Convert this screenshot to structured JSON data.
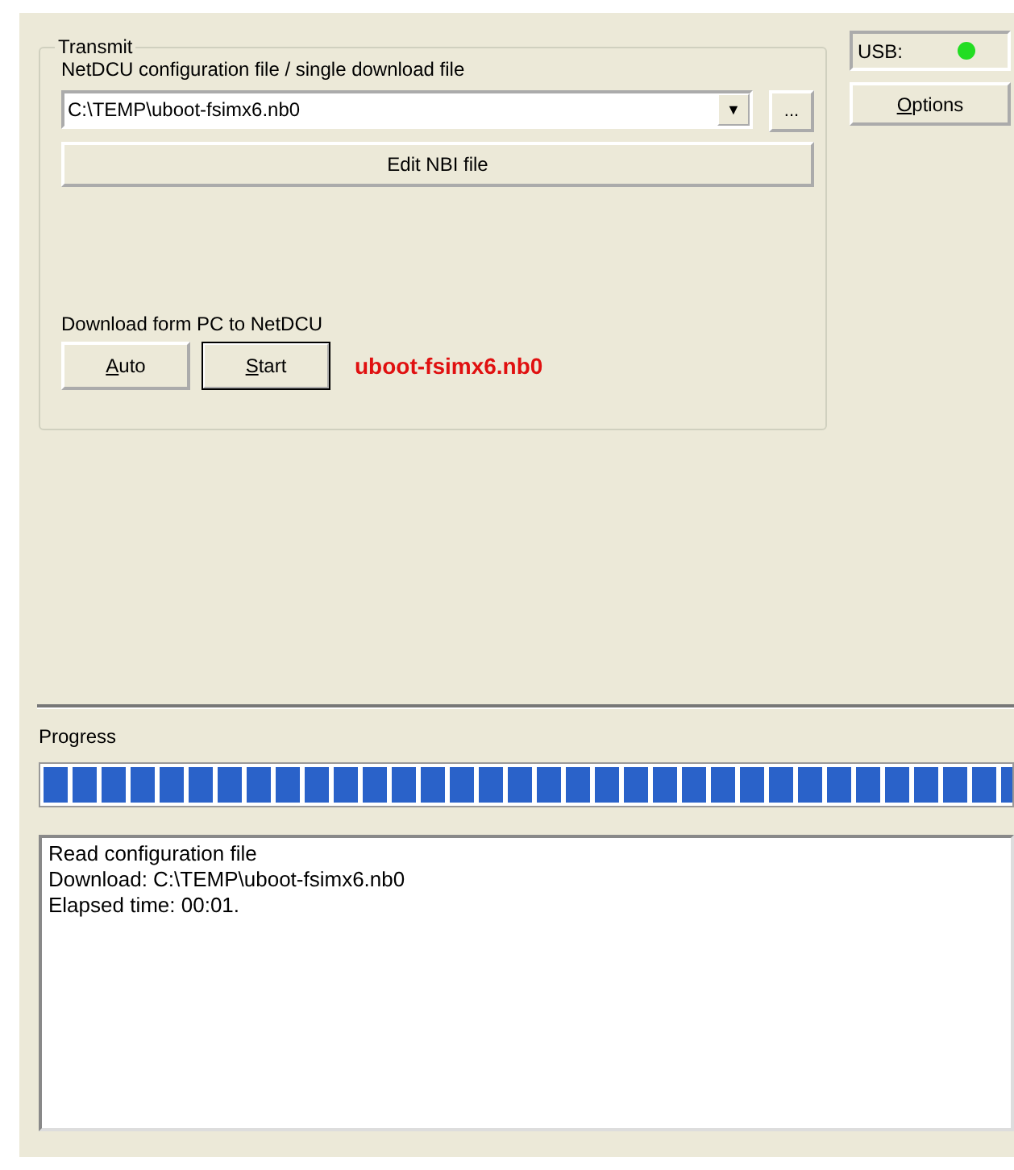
{
  "transmit": {
    "title": "Transmit",
    "file_label": "NetDCU configuration file / single download file",
    "file_value": "C:\\TEMP\\uboot-fsimx6.nb0",
    "dropdown_arrow": "▼",
    "browse_button": "...",
    "edit_button": "Edit NBI file",
    "download_label": "Download form PC to NetDCU",
    "buttons": [
      {
        "label": "Auto",
        "first_letter_underlined": true,
        "default": false
      },
      {
        "label": "Start",
        "first_letter_underlined": true,
        "default": true
      }
    ],
    "status_file": "uboot-fsimx6.nb0"
  },
  "usb": {
    "label": "USB:",
    "on": true
  },
  "options_button": {
    "label": "Options",
    "first_letter_underlined": true
  },
  "progress": {
    "label": "Progress",
    "level": 1
  },
  "log": [
    "Read configuration file",
    "Download: C:\\TEMP\\uboot-fsimx6.nb0",
    "Elapsed time: 00:01."
  ]
}
